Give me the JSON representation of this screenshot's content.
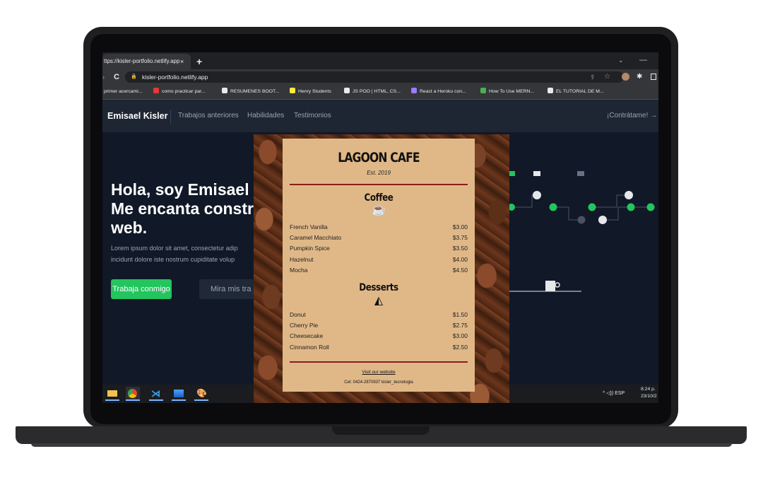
{
  "browser": {
    "tab_title": "ttps://kisler-portfolio.netlify.app",
    "tab_close": "×",
    "new_tab": "+",
    "url": "kisler-portfolio.netlify.app",
    "bookmarks": [
      {
        "label": "primer acercami...",
        "color": "#35363a"
      },
      {
        "label": "como practicar par...",
        "color": "#e53935"
      },
      {
        "label": "RESUMENES BOOT...",
        "color": "#e8eaed"
      },
      {
        "label": "Henry Students",
        "color": "#ffeb3b"
      },
      {
        "label": "JS POO | HTML, CS...",
        "color": "#e8eaed"
      },
      {
        "label": "React a Heroku con...",
        "color": "#9c7cff"
      },
      {
        "label": "How To Use MERN...",
        "color": "#4caf50"
      },
      {
        "label": "EL TUTORIAL DE M...",
        "color": "#e8eaed"
      }
    ]
  },
  "site": {
    "brand": "Emisael Kisler",
    "nav": [
      "Trabajos anteriores",
      "Habilidades",
      "Testimonios"
    ],
    "cta": "¡Contrátame! →",
    "hero_line1": "Hola, soy Emisael",
    "hero_line2": "Me encanta constru",
    "hero_line3": "web.",
    "hero_p1": "Lorem ipsum dolor sit amet, consectetur adip",
    "hero_p2": "incidunt dolore iste nostrum cupiditate volup",
    "btn_primary": "Trabaja conmigo",
    "btn_secondary": "Mira mis tra",
    "accent": "#22c55e"
  },
  "menu": {
    "title": "LAGOON CAFE",
    "est": "Est. 2019",
    "coffee_title": "Coffee",
    "coffee_icon": "coffee-cup-icon",
    "coffee": [
      {
        "name": "French Vanilla",
        "price": "$3.00"
      },
      {
        "name": "Caramel Macchiato",
        "price": "$3.75"
      },
      {
        "name": "Pumpkin Spice",
        "price": "$3.50"
      },
      {
        "name": "Hazelnut",
        "price": "$4.00"
      },
      {
        "name": "Mocha",
        "price": "$4.50"
      }
    ],
    "desserts_title": "Desserts",
    "desserts_icon": "pie-slice-icon",
    "desserts": [
      {
        "name": "Donut",
        "price": "$1.50"
      },
      {
        "name": "Cherry Pie",
        "price": "$2.75"
      },
      {
        "name": "Cheesecake",
        "price": "$3.00"
      },
      {
        "name": "Cinnamon Roll",
        "price": "$2.50"
      }
    ],
    "link": "Visit our website",
    "contact": "Cel: 0424-2870937 kisler_tecnologia",
    "rule_color": "#8b1c1c",
    "paper_color": "#e0b888"
  },
  "taskbar": {
    "tray": "^  ◁))  ESP",
    "time": "8:24 p.",
    "date": "23/10/2"
  }
}
